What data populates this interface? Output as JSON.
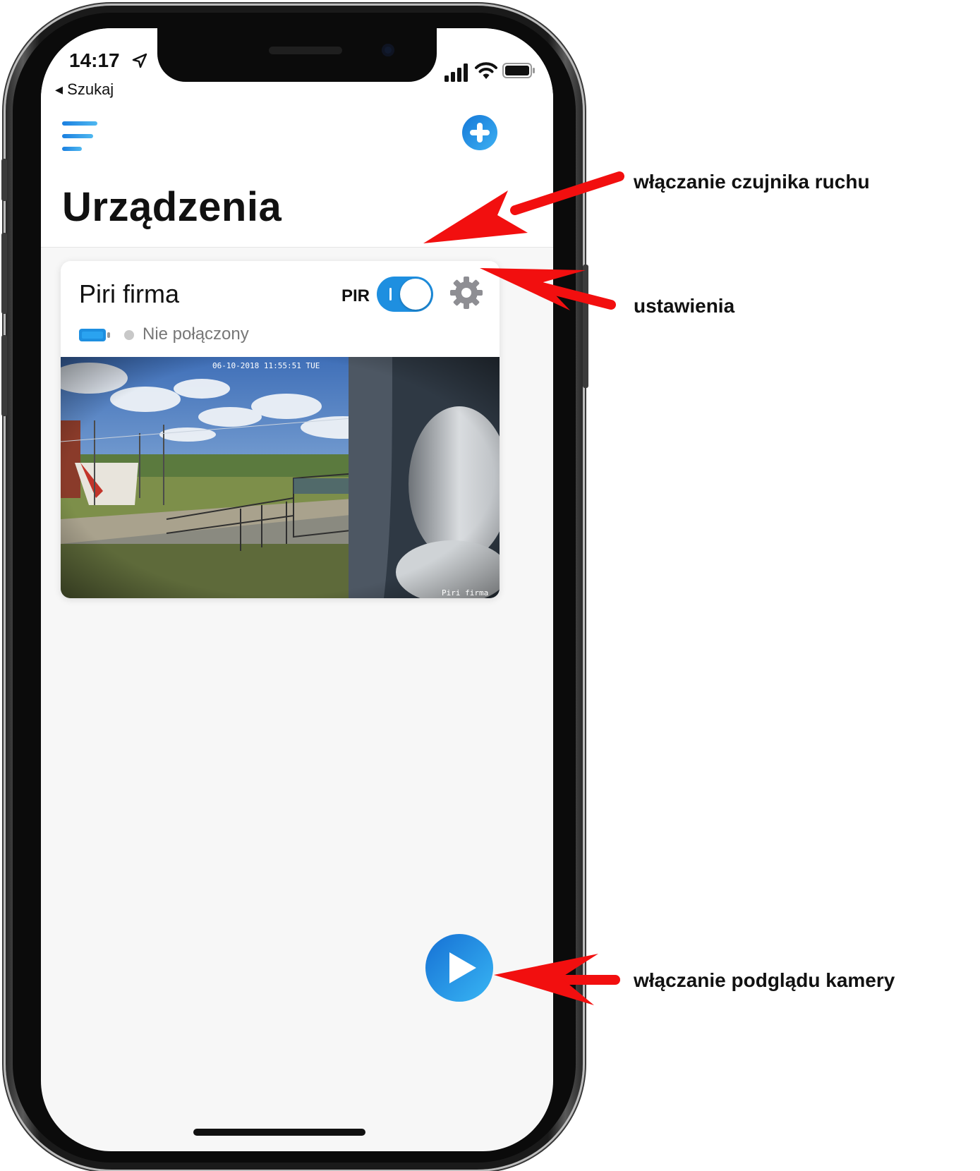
{
  "status_bar": {
    "time": "14:17",
    "back_label": "◂ Szukaj"
  },
  "header": {
    "title": "Urządzenia"
  },
  "device": {
    "name": "Piri firma",
    "pir_label": "PIR",
    "pir_enabled": true,
    "status_text": "Nie połączony",
    "preview_timestamp": "06-10-2018 11:55:51 TUE",
    "preview_caption": "Piri firma"
  },
  "annotations": {
    "motion_sensor": "włączanie czujnika ruchu",
    "settings": "ustawienia",
    "camera_preview": "włączanie podglądu kamery"
  },
  "colors": {
    "accent": "#1e8fe0",
    "arrow": "#f20f0f",
    "gear": "#8e8e93"
  },
  "icons": [
    "location-arrow-icon",
    "signal-icon",
    "wifi-icon",
    "battery-icon",
    "menu-icon",
    "add-icon",
    "gear-icon",
    "device-battery-icon",
    "play-icon"
  ]
}
